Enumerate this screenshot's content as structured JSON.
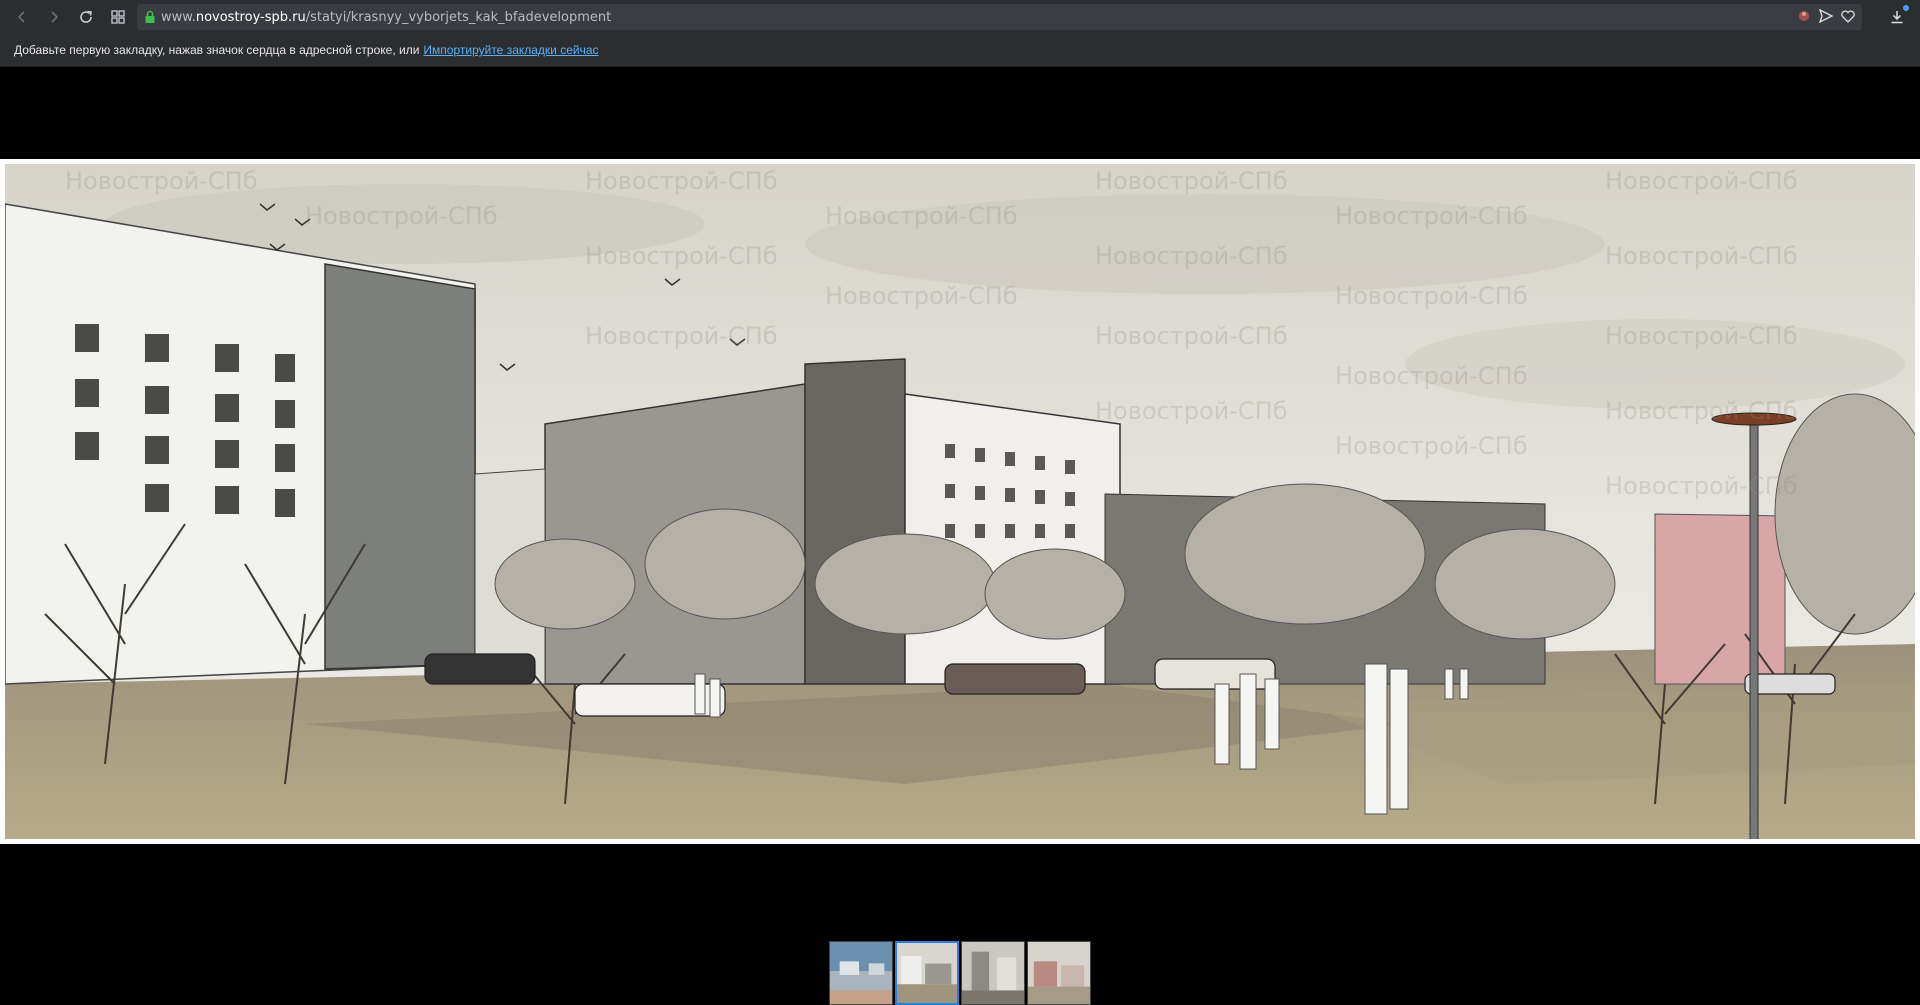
{
  "browser": {
    "url_prefix": "www.",
    "url_domain": "novostroy-spb.ru",
    "url_path": "/statyi/krasnyy_vyborjets_kak_bfadevelopment"
  },
  "bookmarks_bar": {
    "message": "Добавьте первую закладку, нажав значок сердца в адресной строке, или",
    "link": "Импортируйте закладки сейчас"
  },
  "viewer": {
    "watermark": "Новострой-СПб",
    "thumbnails": [
      {
        "label": "thumbnail-1"
      },
      {
        "label": "thumbnail-2"
      },
      {
        "label": "thumbnail-3"
      },
      {
        "label": "thumbnail-4"
      }
    ]
  },
  "colors": {
    "accent": "#2f7be0",
    "chrome": "#2b2d31",
    "link": "#5ab0f5"
  }
}
